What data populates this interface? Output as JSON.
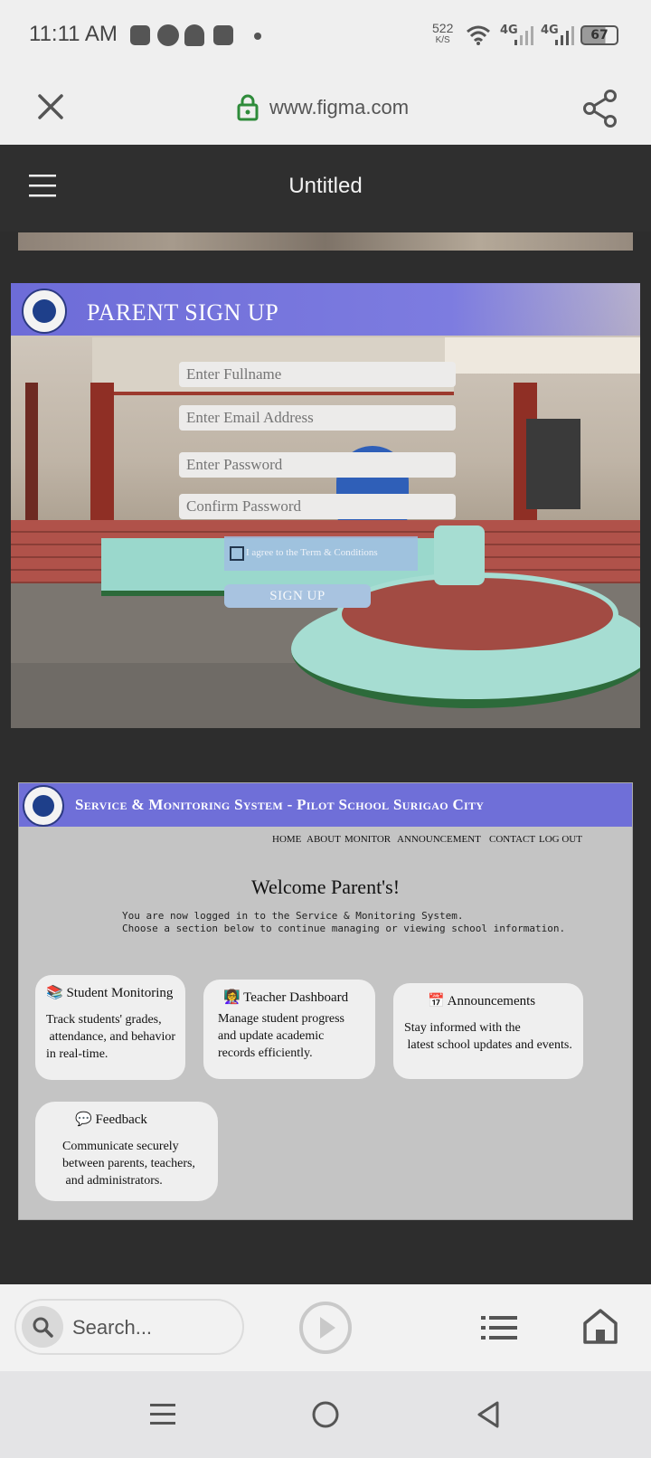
{
  "status_bar": {
    "time": "11:11 AM",
    "speed_value": "522",
    "speed_unit": "K/S",
    "net1": "4G",
    "net2": "4G",
    "battery": "67"
  },
  "browser": {
    "url": "www.figma.com"
  },
  "figma": {
    "title": "Untitled"
  },
  "signup": {
    "title": "PARENT SIGN UP",
    "fullname_placeholder": "Enter Fullname",
    "email_placeholder": "Enter Email Address",
    "password_placeholder": "Enter Password",
    "confirm_placeholder": "Confirm Password",
    "agree_label": "I agree to the Term & Conditions",
    "button": "SIGN UP"
  },
  "dashboard": {
    "title": "Service & Monitoring System - Pilot School Surigao City",
    "nav": [
      "HOME",
      "ABOUT",
      "MONITOR",
      "ANNOUNCEMENT",
      "CONTACT",
      "LOG OUT"
    ],
    "welcome": "Welcome Parent's!",
    "intro": "You are now logged in to the Service & Monitoring System.\nChoose a section below to continue managing or viewing school information.",
    "cards": [
      {
        "icon": "📚",
        "title": "Student Monitoring",
        "body": "Track students' grades,\n attendance, and behavior\nin real-time."
      },
      {
        "icon": "👩‍🏫",
        "title": "Teacher Dashboard",
        "body": "Manage student progress\nand update academic\nrecords efficiently."
      },
      {
        "icon": "📅",
        "title": "Announcements",
        "body": "Stay informed with the\n latest school updates and events."
      },
      {
        "icon": "💬",
        "title": "Feedback",
        "body": "Communicate securely\nbetween parents, teachers,\n and administrators."
      }
    ]
  },
  "bottom": {
    "search_placeholder": "Search..."
  },
  "colors": {
    "banner": "#6f6fd8",
    "dark_bg": "#2d2d2d",
    "lock_green": "#2e8b3a"
  }
}
